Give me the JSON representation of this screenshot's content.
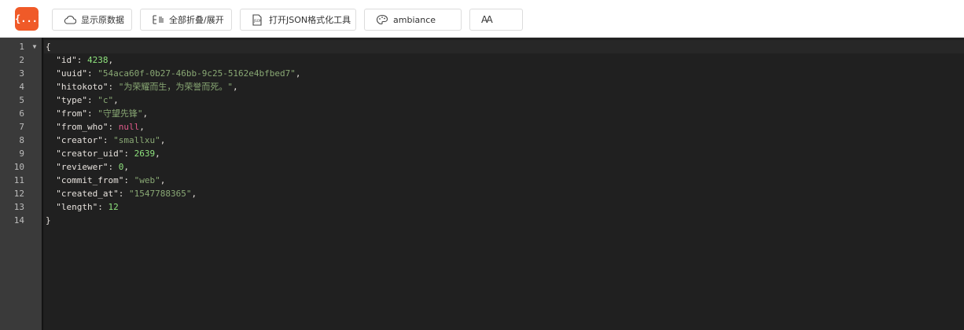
{
  "toolbar": {
    "logo_text": "{...}",
    "raw_label": "显示原数据",
    "fold_label": "全部折叠/展开",
    "json_tool_label": "打开JSON格式化工具",
    "theme_value": "ambiance",
    "font_label": "AA"
  },
  "gutter": {
    "lines": [
      "1",
      "2",
      "3",
      "4",
      "5",
      "6",
      "7",
      "8",
      "9",
      "10",
      "11",
      "12",
      "13",
      "14"
    ]
  },
  "json": {
    "open": "{",
    "close": "}",
    "entries": [
      {
        "key": "\"id\"",
        "value": "4238",
        "kind": "num",
        "comma": ","
      },
      {
        "key": "\"uuid\"",
        "value": "\"54aca60f-0b27-46bb-9c25-5162e4bfbed7\"",
        "kind": "str",
        "comma": ","
      },
      {
        "key": "\"hitokoto\"",
        "value": "\"为荣耀而生，为荣誉而死。\"",
        "kind": "str",
        "comma": ","
      },
      {
        "key": "\"type\"",
        "value": "\"c\"",
        "kind": "str",
        "comma": ","
      },
      {
        "key": "\"from\"",
        "value": "\"守望先锋\"",
        "kind": "str",
        "comma": ","
      },
      {
        "key": "\"from_who\"",
        "value": "null",
        "kind": "nul",
        "comma": ","
      },
      {
        "key": "\"creator\"",
        "value": "\"smallxu\"",
        "kind": "str",
        "comma": ","
      },
      {
        "key": "\"creator_uid\"",
        "value": "2639",
        "kind": "num",
        "comma": ","
      },
      {
        "key": "\"reviewer\"",
        "value": "0",
        "kind": "num",
        "comma": ","
      },
      {
        "key": "\"commit_from\"",
        "value": "\"web\"",
        "kind": "str",
        "comma": ","
      },
      {
        "key": "\"created_at\"",
        "value": "\"1547788365\"",
        "kind": "str",
        "comma": ","
      },
      {
        "key": "\"length\"",
        "value": "12",
        "kind": "num",
        "comma": ""
      }
    ]
  },
  "colors": {
    "logo": "#f05a28",
    "editor_bg": "#202020",
    "gutter_bg": "#3a3a3a",
    "number": "#8ee27d",
    "string": "#89a874",
    "null": "#e05a8a"
  }
}
